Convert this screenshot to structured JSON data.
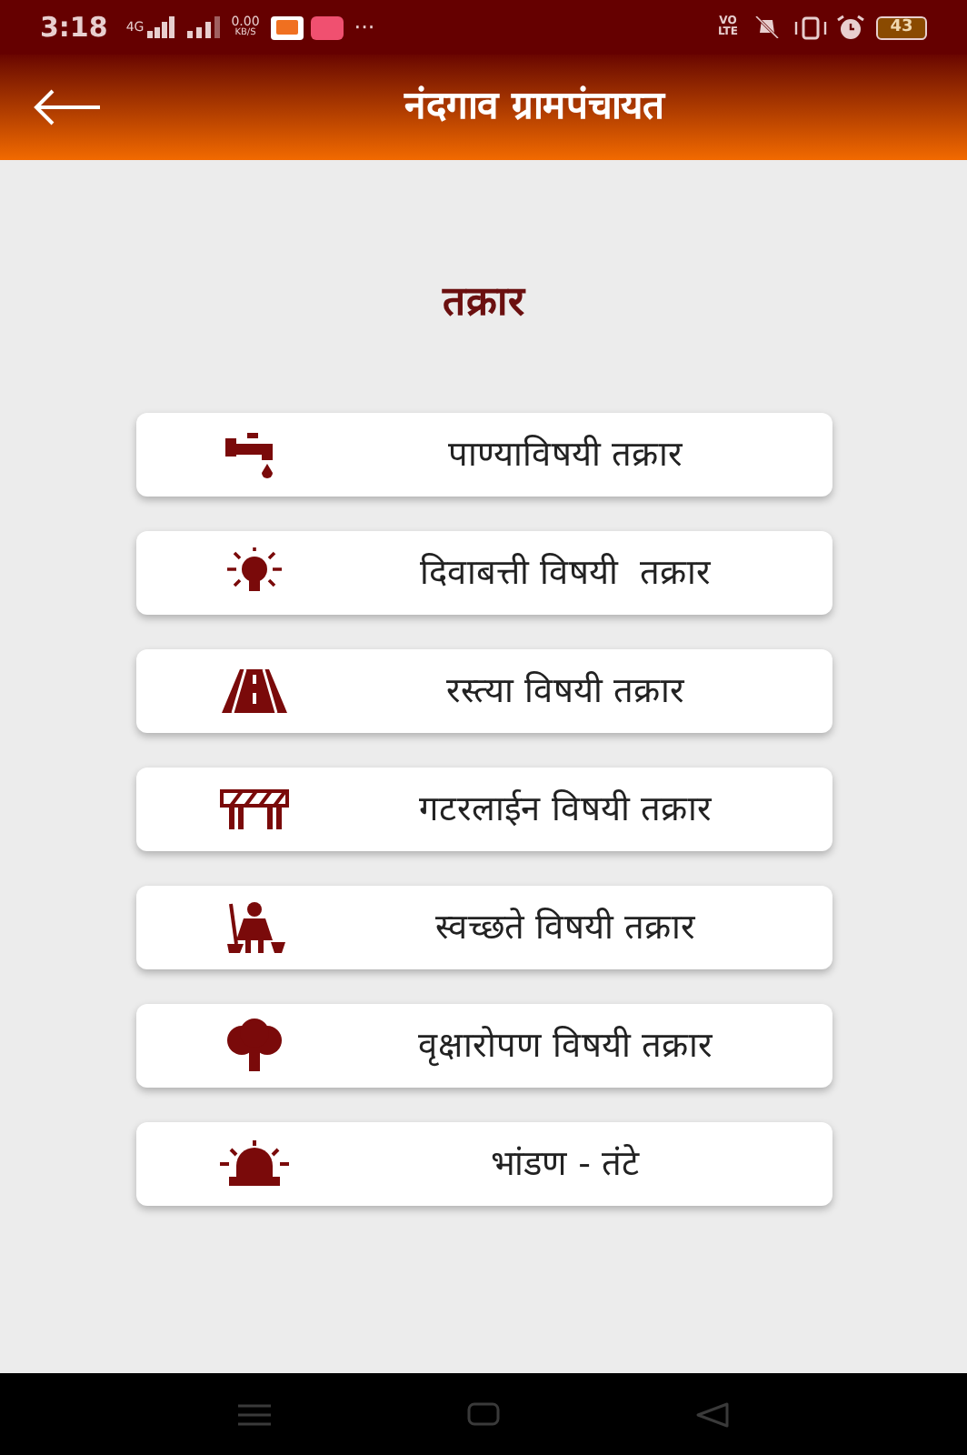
{
  "status_bar": {
    "time": "3:18",
    "network_type": "4G",
    "speed": "0.00",
    "speed_unit": "KB/S",
    "more": "···",
    "volte_top": "VO",
    "volte_bottom": "LTE",
    "battery": "43"
  },
  "header": {
    "title": "नंदगाव ग्रामपंचायत"
  },
  "page_title": "तक्रार",
  "items": [
    {
      "label": "पाण्याविषयी तक्रार"
    },
    {
      "label": "दिवाबत्ती विषयी  तक्रार"
    },
    {
      "label": "रस्त्या विषयी तक्रार"
    },
    {
      "label": "गटरलाईन विषयी तक्रार"
    },
    {
      "label": "स्वच्छते विषयी तक्रार"
    },
    {
      "label": "वृक्षारोपण विषयी तक्रार"
    },
    {
      "label": "भांडण - तंटे"
    }
  ]
}
